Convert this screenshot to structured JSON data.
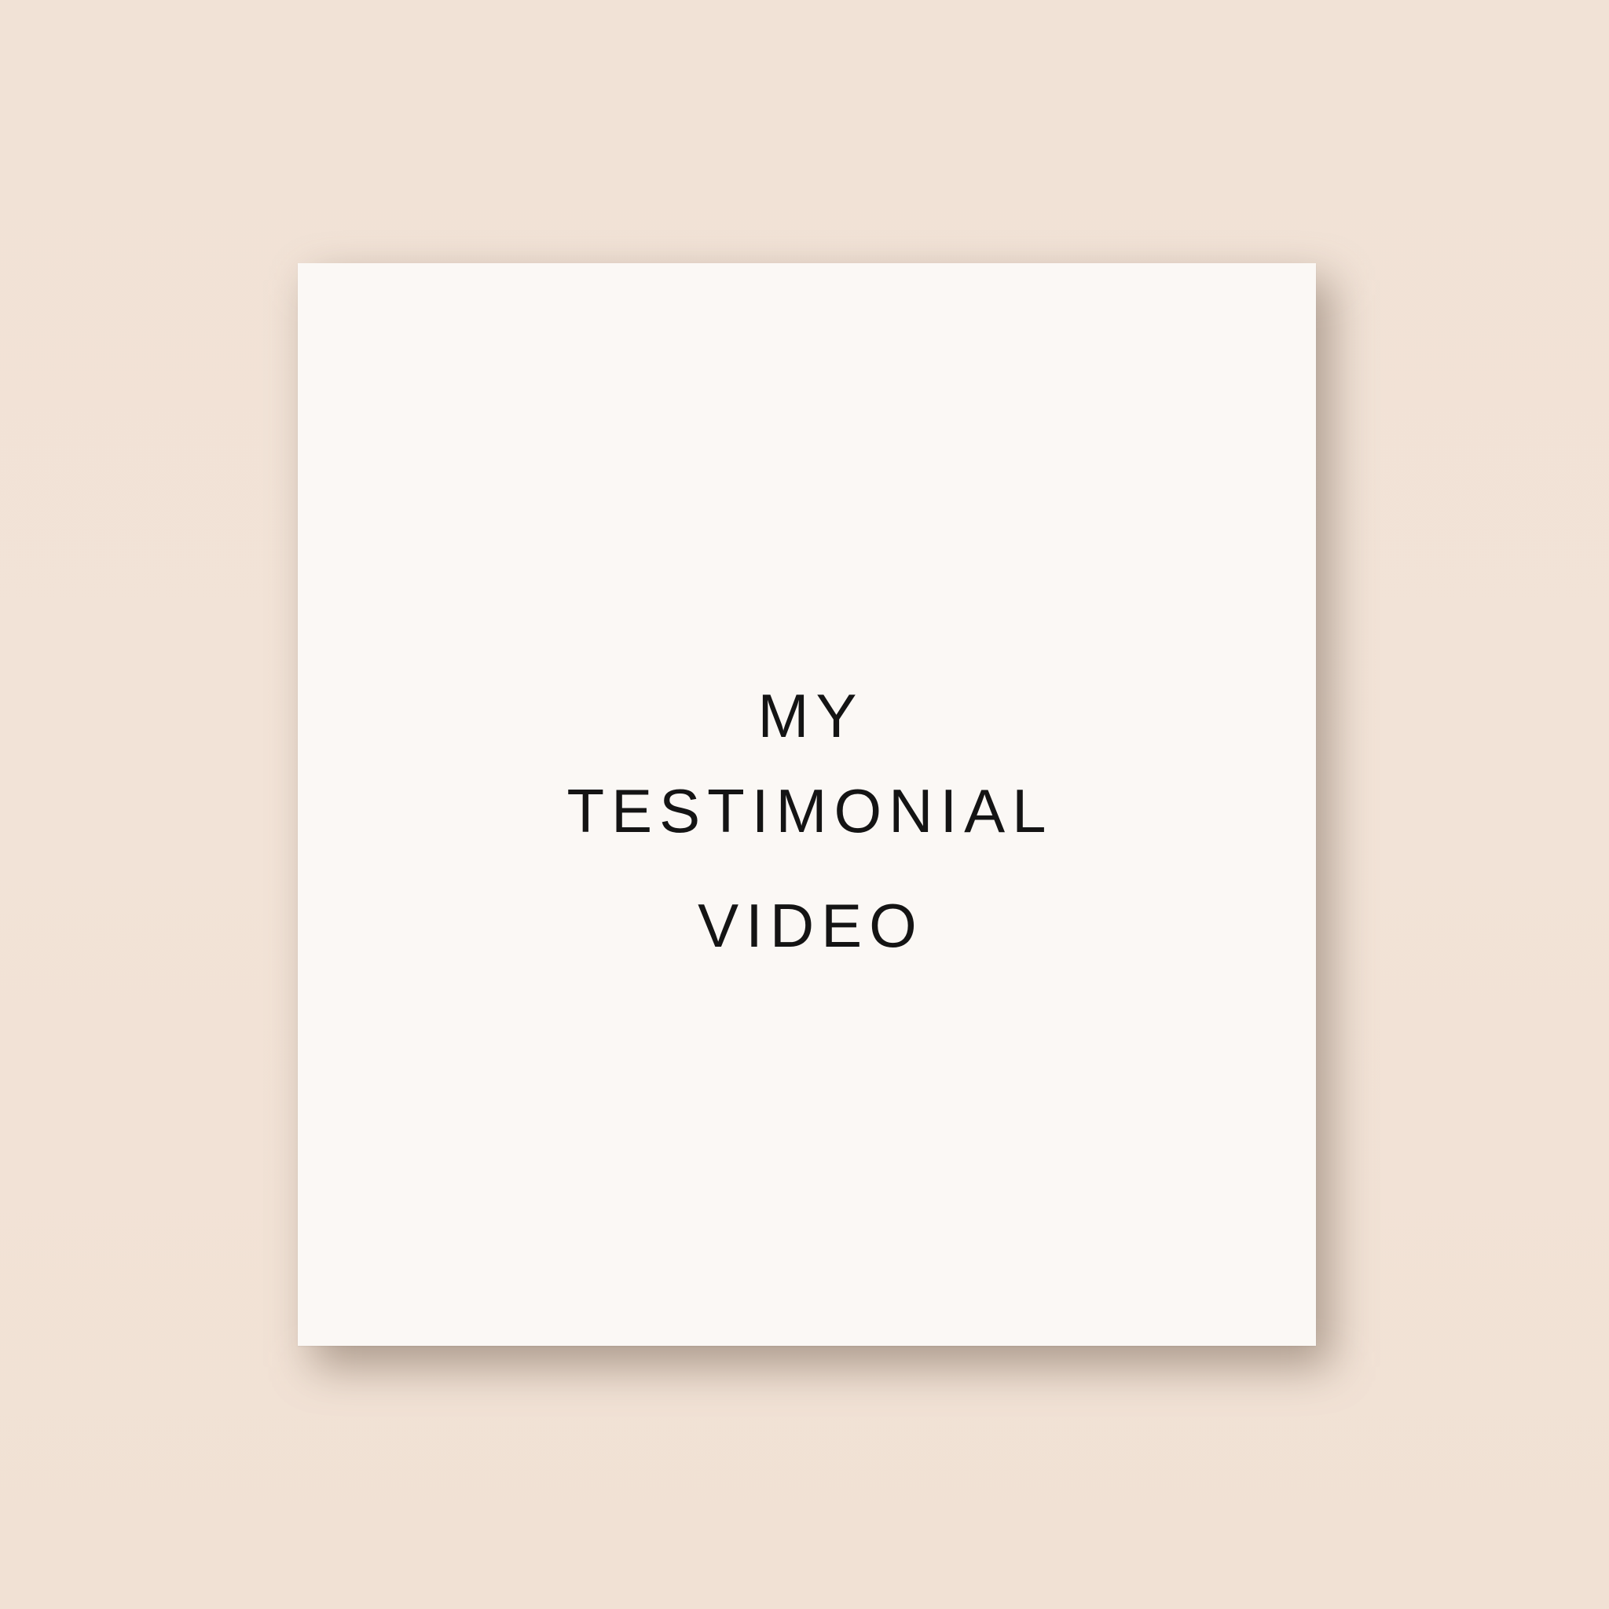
{
  "card": {
    "title_lines": [
      "MY",
      "TESTIMONIAL",
      "VIDEO"
    ]
  },
  "colors": {
    "background": "#f2e3d7",
    "card": "#fbf8f5",
    "text": "#141414"
  }
}
